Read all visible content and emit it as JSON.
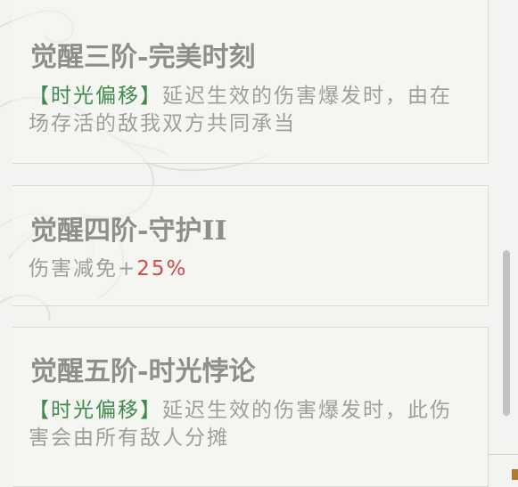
{
  "cards": [
    {
      "title": "觉醒三阶-完美时刻",
      "keyword": "【时光偏移】",
      "description": "延迟生效的伤害爆发时，由在场存活的敌我双方共同承当"
    },
    {
      "title": "觉醒四阶-守护II",
      "description_prefix": "伤害减免+",
      "value": "25%"
    },
    {
      "title": "觉醒五阶-时光悖论",
      "keyword": "【时光偏移】",
      "description": "延迟生效的伤害爆发时，此伤害会由所有敌人分摊"
    }
  ],
  "colors": {
    "title": "#8e8e8c",
    "text": "#9e9e9c",
    "keyword": "#3f8a4c",
    "value": "#d24a4a",
    "background": "#f3f3f1"
  }
}
